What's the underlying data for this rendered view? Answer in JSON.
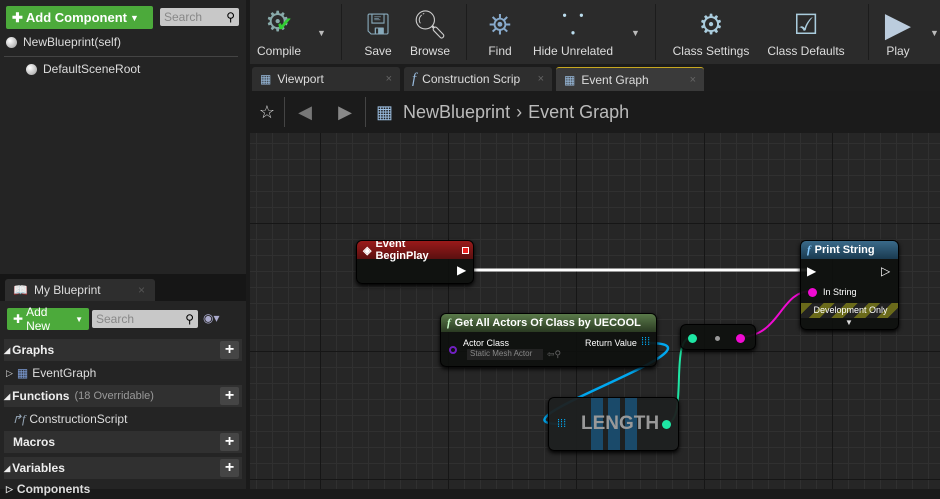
{
  "components": {
    "add_label": "Add Component",
    "search_placeholder": "Search",
    "items": [
      "NewBlueprint(self)",
      "DefaultSceneRoot"
    ]
  },
  "my_blueprint": {
    "tab": "My Blueprint",
    "add_label": "Add New",
    "search_placeholder": "Search",
    "sections": {
      "graphs": "Graphs",
      "functions": "Functions",
      "functions_note": "(18 Overridable)",
      "macros": "Macros",
      "variables": "Variables",
      "components": "Components"
    },
    "items": {
      "event_graph": "EventGraph",
      "construction_script": "ConstructionScript"
    }
  },
  "toolbar": {
    "compile": "Compile",
    "save": "Save",
    "browse": "Browse",
    "find": "Find",
    "hide_unrelated": "Hide Unrelated",
    "class_settings": "Class Settings",
    "class_defaults": "Class Defaults",
    "play": "Play"
  },
  "tabs": [
    "Viewport",
    "Construction Scrip",
    "Event Graph"
  ],
  "breadcrumb": {
    "root": "NewBlueprint",
    "current": "Event Graph"
  },
  "nodes": {
    "begin_play": {
      "title": "Event BeginPlay"
    },
    "print_string": {
      "title": "Print String",
      "in_string": "In String",
      "dev_only": "Development Only"
    },
    "get_all_actors": {
      "title": "Get All Actors Of Class by UECOOL",
      "actor_class": "Actor Class",
      "class_value": "Static Mesh Actor",
      "return_value": "Return Value"
    },
    "length": {
      "title": "LENGTH"
    }
  },
  "colors": {
    "exec": "#ffffff",
    "array": "#00a8f0",
    "int": "#1ee6a4",
    "string": "#f00ad2",
    "green": "#4caa3b"
  }
}
